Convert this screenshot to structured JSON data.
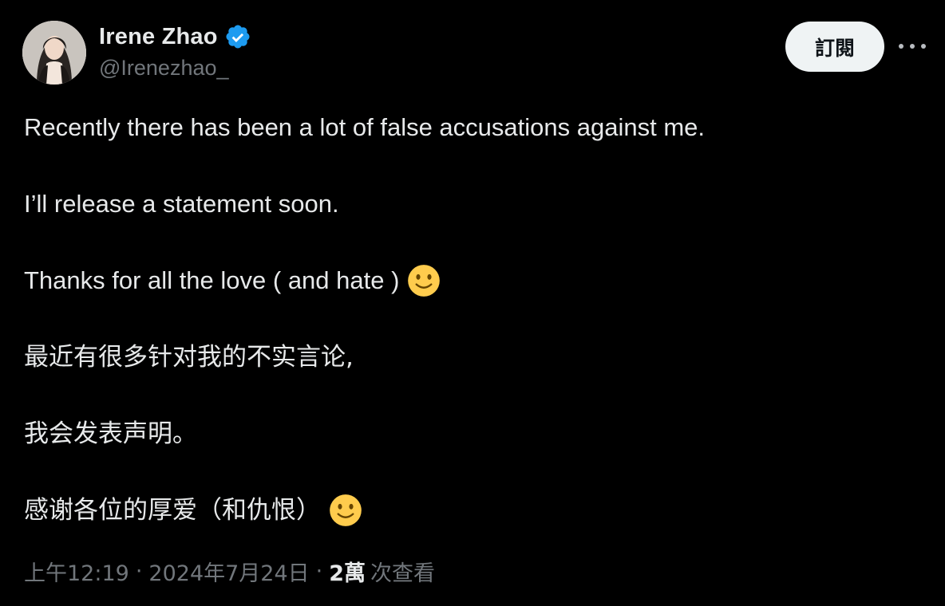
{
  "author": {
    "display_name": "Irene Zhao",
    "handle": "@Irenezhao_",
    "verified": true,
    "verified_color": "#1d9bf0"
  },
  "actions": {
    "subscribe_label": "訂閱",
    "more_icon": "more-horizontal-icon"
  },
  "tweet": {
    "lines": [
      "Recently there has been a lot of false accusations against me.",
      "I’ll release a statement soon.",
      "Thanks for all the love ( and hate )",
      "最近有很多针对我的不实言论,",
      "我会发表声明。",
      "感谢各位的厚爱（和仇恨）"
    ],
    "emoji": "slightly-smiling-face-icon"
  },
  "meta": {
    "time": "上午12:19",
    "separator": "·",
    "date": "2024年7月24日",
    "views_count": "2萬",
    "views_label": "次查看"
  },
  "colors": {
    "background": "#000000",
    "text": "#e7e9ea",
    "secondary_text": "#71767b",
    "button_bg": "#eff3f4"
  }
}
